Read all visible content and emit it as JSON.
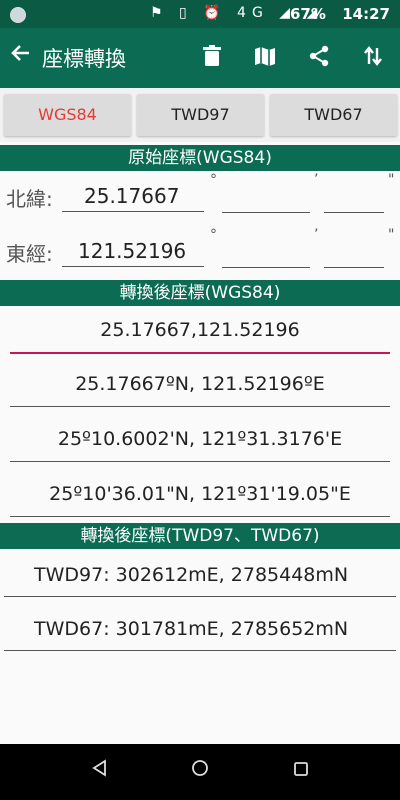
{
  "status": {
    "battery": "67%",
    "time": "14:27",
    "icons": "⚑ ▯ ⏰ 4G ◢ ◢"
  },
  "appbar": {
    "title": "座標轉換"
  },
  "tabs": [
    "WGS84",
    "TWD97",
    "TWD67"
  ],
  "original": {
    "header": "原始座標(WGS84)",
    "lat_label": "北緯:",
    "lat_value": "25.17667",
    "lon_label": "東經:",
    "lon_value": "121.52196",
    "deg": "°",
    "min": "’",
    "sec": "\""
  },
  "converted": {
    "header": "轉換後座標(WGS84)",
    "lines": [
      "25.17667,121.52196",
      "25.17667ºN,  121.52196ºE",
      "25º10.6002'N, 121º31.3176'E",
      "25º10'36.01\"N, 121º31'19.05\"E"
    ]
  },
  "twd": {
    "header": "轉換後座標(TWD97、TWD67)",
    "twd97": "TWD97: 302612mE, 2785448mN",
    "twd67": "TWD67: 301781mE, 2785652mN"
  },
  "colors": {
    "primary": "#0b6b53",
    "statusbar": "#0b5a44",
    "active_tab": "#e53935",
    "focus_line": "#c2185b"
  }
}
